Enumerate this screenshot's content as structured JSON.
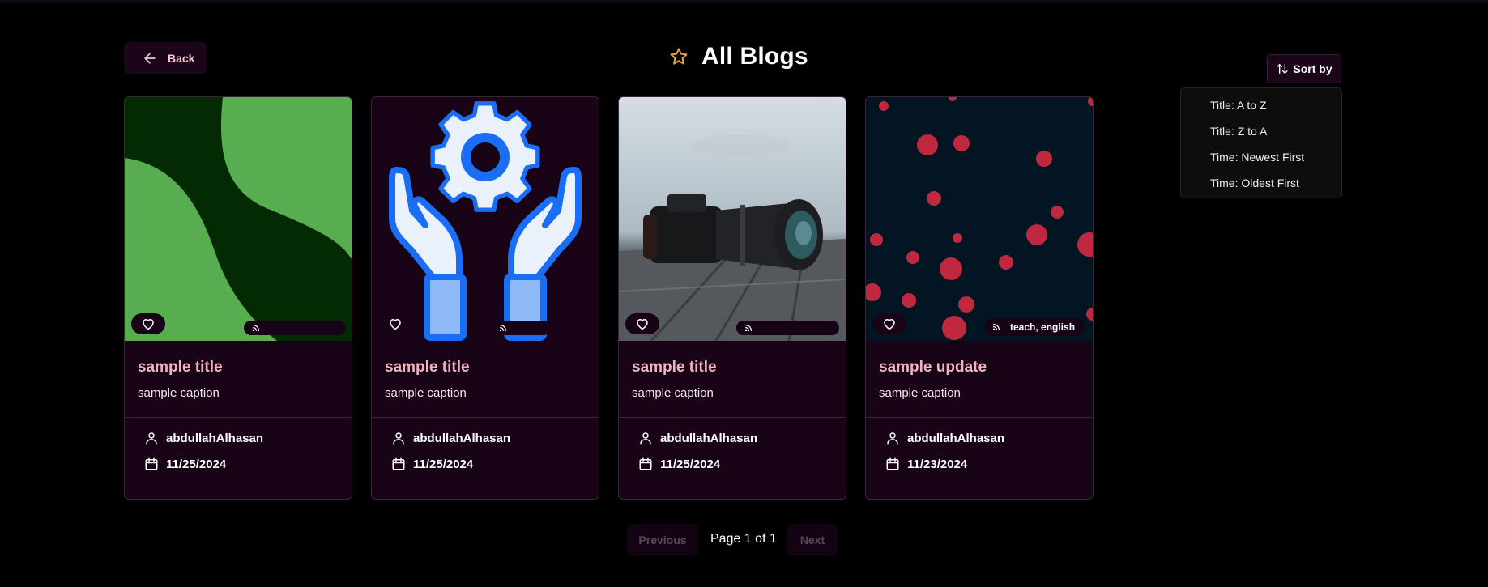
{
  "header": {
    "back_label": "Back",
    "title": "All Blogs",
    "sort_label": "Sort by"
  },
  "sort_menu": {
    "options": [
      "Title: A to Z",
      "Title: Z to A",
      "Time: Newest First",
      "Time: Oldest First"
    ]
  },
  "cards": [
    {
      "title": "sample title",
      "caption": "sample caption",
      "author": "abdullahAlhasan",
      "date": "11/25/2024",
      "tags": "",
      "image": "green-abstract"
    },
    {
      "title": "sample title",
      "caption": "sample caption",
      "author": "abdullahAlhasan",
      "date": "11/25/2024",
      "tags": "",
      "image": "gear-hands"
    },
    {
      "title": "sample title",
      "caption": "sample caption",
      "author": "abdullahAlhasan",
      "date": "11/25/2024",
      "tags": "",
      "image": "camera-photo"
    },
    {
      "title": "sample update",
      "caption": "sample caption",
      "author": "abdullahAlhasan",
      "date": "11/23/2024",
      "tags": "teach, english",
      "image": "red-dots"
    }
  ],
  "pagination": {
    "previous_label": "Previous",
    "page_text": "Page 1 of 1",
    "next_label": "Next"
  },
  "icons": {
    "back": "arrow-left-icon",
    "title": "star-icon",
    "sort": "arrow-up-down-icon",
    "like": "heart-icon",
    "tag": "rss-icon",
    "author": "user-icon",
    "date": "calendar-icon"
  },
  "colors": {
    "background": "#000000",
    "card_background": "#180416",
    "title_accent": "#f2b3bd",
    "star": "#e6a23c",
    "muted_button": "#140312"
  }
}
